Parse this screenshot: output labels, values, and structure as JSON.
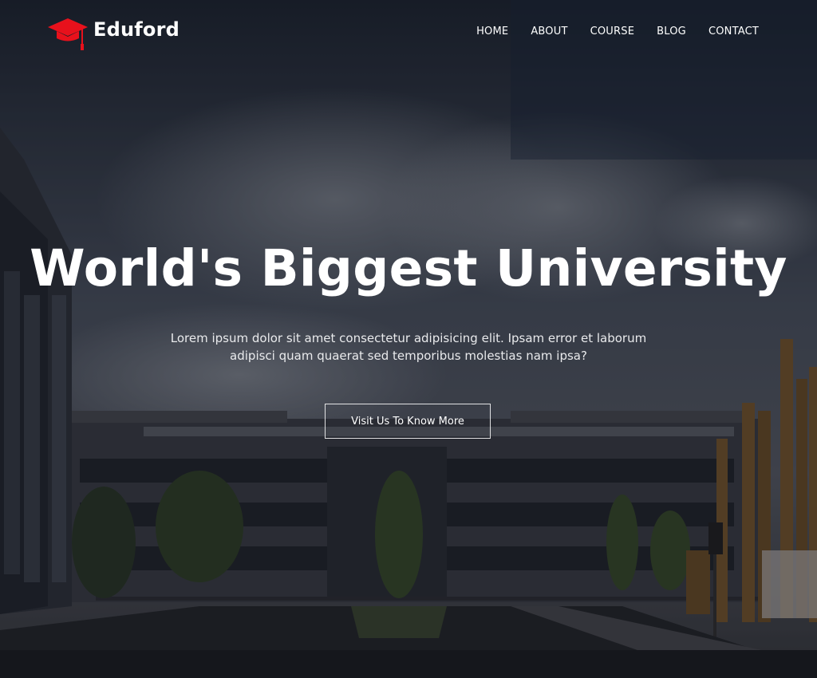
{
  "brand": {
    "name": "Eduford",
    "accent": "#e8111c"
  },
  "nav": [
    "HOME",
    "ABOUT",
    "COURSE",
    "BLOG",
    "CONTACT"
  ],
  "hero": {
    "title": "World's Biggest University",
    "subtitle_line1": "Lorem ipsum dolor sit amet consectetur adipisicing elit. Ipsam error et laborum",
    "subtitle_line2": "adipisci quam quaerat sed temporibus molestias nam ipsa?",
    "cta_label": "Visit Us To Know More"
  }
}
